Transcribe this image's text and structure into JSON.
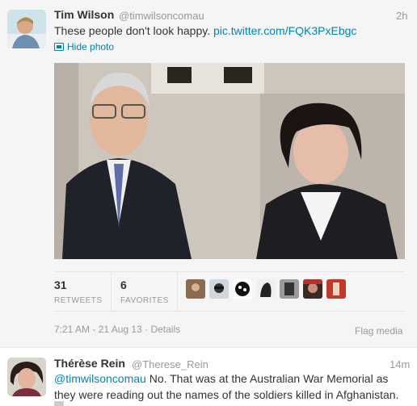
{
  "tweets": [
    {
      "name": "Tim Wilson",
      "handle": "@timwilsoncomau",
      "time": "2h",
      "text": "These people don't look happy.",
      "link": "pic.twitter.com/FQK3PxEbgc",
      "hide_photo_label": "Hide photo",
      "retweets_count": "31",
      "retweets_label": "RETWEETS",
      "favorites_count": "6",
      "favorites_label": "FAVORITES",
      "timestamp": "7:21 AM - 21 Aug 13",
      "details_label": "Details",
      "flag_label": "Flag media",
      "avatar_icon": "user-avatar-icon"
    },
    {
      "name": "Thérèse Rein",
      "handle": "@Therese_Rein",
      "time": "14m",
      "mention": "@timwilsoncomau",
      "text_line1": " No. That was at the Australian War Memorial as",
      "text_line2": "they were reading out the names of the soldiers killed in Afghanistan.",
      "avatar_icon": "user-avatar-icon"
    }
  ],
  "colors": {
    "link": "#0084b4",
    "muted": "#999999",
    "text": "#333333",
    "expanded_bg": "#f5f5f5"
  }
}
